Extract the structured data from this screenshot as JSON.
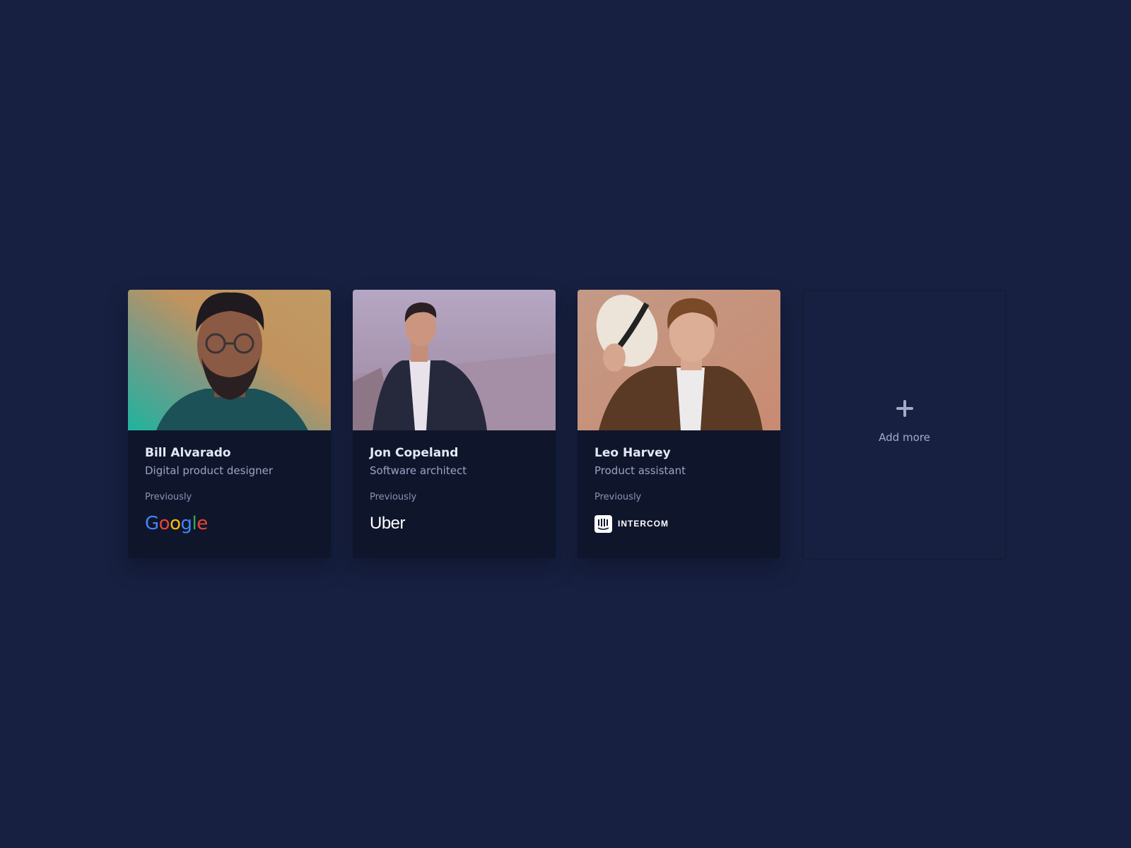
{
  "team": {
    "members": [
      {
        "name": "Bill Alvarado",
        "role": "Digital product designer",
        "previously_label": "Previously",
        "company": "Google"
      },
      {
        "name": "Jon Copeland",
        "role": "Software architect",
        "previously_label": "Previously",
        "company": "Uber"
      },
      {
        "name": "Leo Harvey",
        "role": "Product assistant",
        "previously_label": "Previously",
        "company": "INTERCOM"
      }
    ],
    "add_more_label": "Add more"
  },
  "colors": {
    "background": "#172040",
    "card": "#0f162c",
    "name_text": "#e4e8f5",
    "muted_text": "#9aa3c0"
  },
  "icons": {
    "add": "plus-icon",
    "google": "google-logo",
    "uber": "uber-logo",
    "intercom": "intercom-logo"
  }
}
